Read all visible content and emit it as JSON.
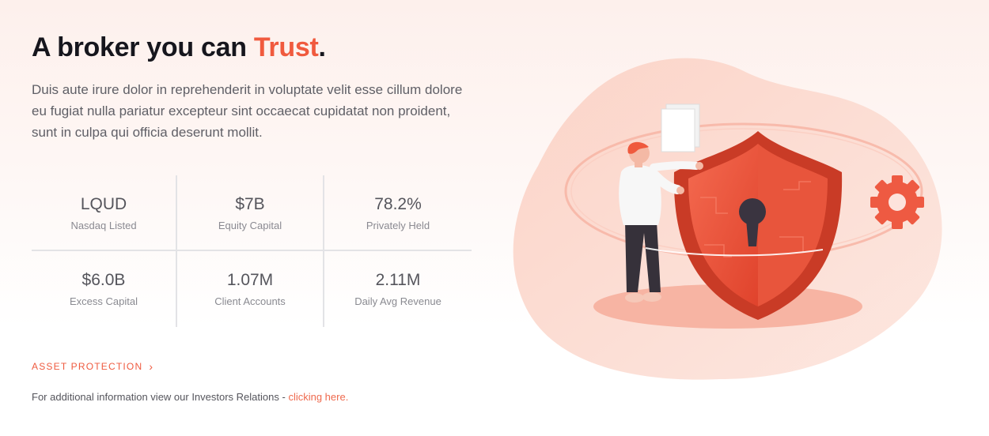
{
  "headline": {
    "prefix": "A broker you can ",
    "accent": "Trust",
    "suffix": "."
  },
  "intro": "Duis aute irure dolor in reprehenderit in voluptate velit esse cillum dolore eu fugiat nulla pariatur excepteur sint occaecat cupidatat non proident, sunt in culpa qui officia deserunt mollit.",
  "stats": [
    {
      "value": "LQUD",
      "label": "Nasdaq Listed"
    },
    {
      "value": "$7B",
      "label": "Equity Capital"
    },
    {
      "value": "78.2%",
      "label": "Privately Held"
    },
    {
      "value": "$6.0B",
      "label": "Excess Capital"
    },
    {
      "value": "1.07M",
      "label": "Client Accounts"
    },
    {
      "value": "2.11M",
      "label": "Daily Avg Revenue"
    }
  ],
  "asset_link": {
    "label": "ASSET PROTECTION",
    "icon": "chevron-right-icon"
  },
  "footer": {
    "text": "For additional information view our Investors Relations - ",
    "link": "clicking here."
  },
  "colors": {
    "accent": "#f05a3e",
    "text": "#16161d",
    "muted": "#5f5f66"
  }
}
